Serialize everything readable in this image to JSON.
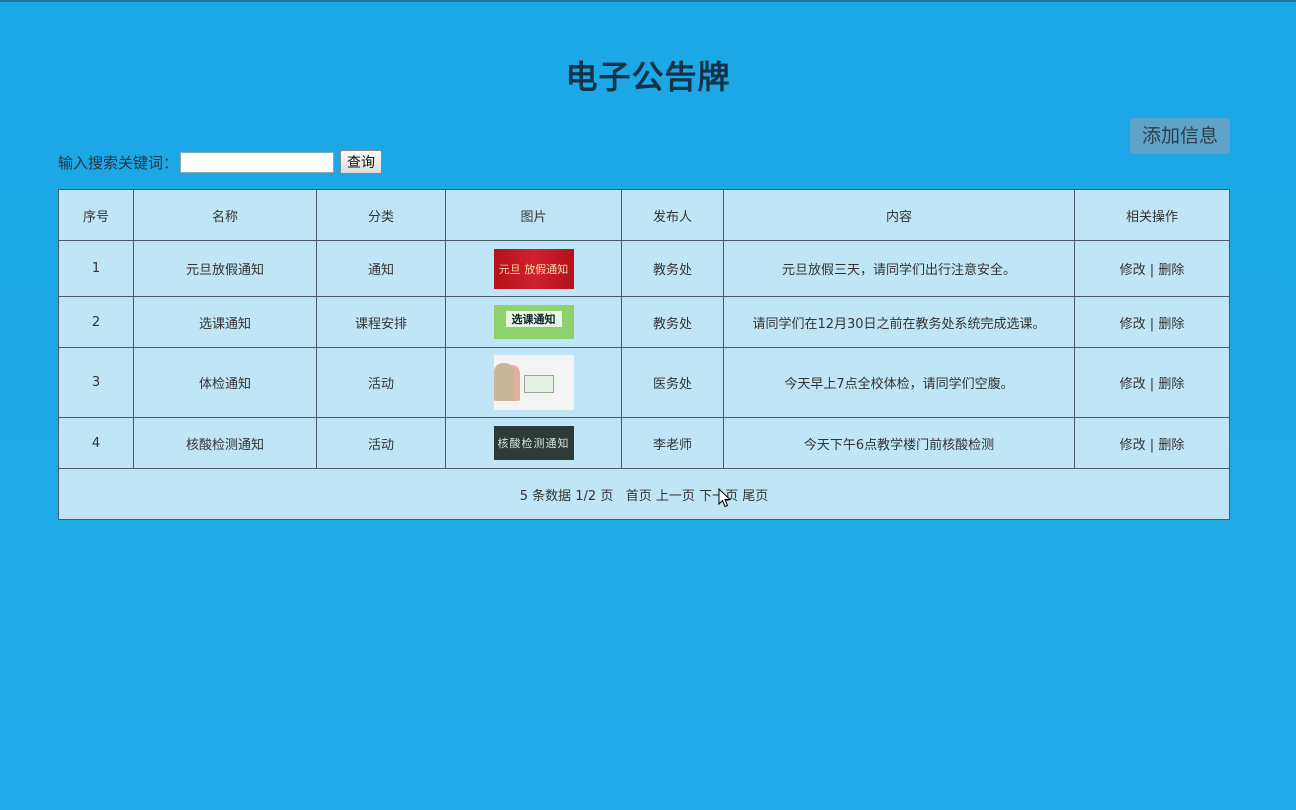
{
  "title": "电子公告牌",
  "add_button": "添加信息",
  "search": {
    "label": "输入搜索关键词：",
    "value": "",
    "button": "查询"
  },
  "table": {
    "headers": [
      "序号",
      "名称",
      "分类",
      "图片",
      "发布人",
      "内容",
      "相关操作"
    ],
    "rows": [
      {
        "id": "1",
        "name": "元旦放假通知",
        "category": "通知",
        "image_text": "元旦 放假通知",
        "publisher": "教务处",
        "content": "元旦放假三天，请同学们出行注意安全。"
      },
      {
        "id": "2",
        "name": "选课通知",
        "category": "课程安排",
        "image_text": "选课通知",
        "publisher": "教务处",
        "content": "请同学们在12月30日之前在教务处系统完成选课。"
      },
      {
        "id": "3",
        "name": "体检通知",
        "category": "活动",
        "image_text": "",
        "publisher": "医务处",
        "content": "今天早上7点全校体检，请同学们空腹。"
      },
      {
        "id": "4",
        "name": "核酸检测通知",
        "category": "活动",
        "image_text": "核酸检测通知",
        "publisher": "李老师",
        "content": "今天下午6点教学楼门前核酸检测"
      }
    ],
    "ops": {
      "edit": "修改",
      "sep": "|",
      "delete": "删除"
    }
  },
  "pager": {
    "summary": "5 条数据 1/2 页",
    "first": "首页",
    "prev": "上一页",
    "next": "下一页",
    "last": "尾页"
  },
  "colors": {
    "background": "#1ea9e6",
    "table_bg": "#c0e5f7",
    "add_button_bg": "#5fa3c9"
  }
}
